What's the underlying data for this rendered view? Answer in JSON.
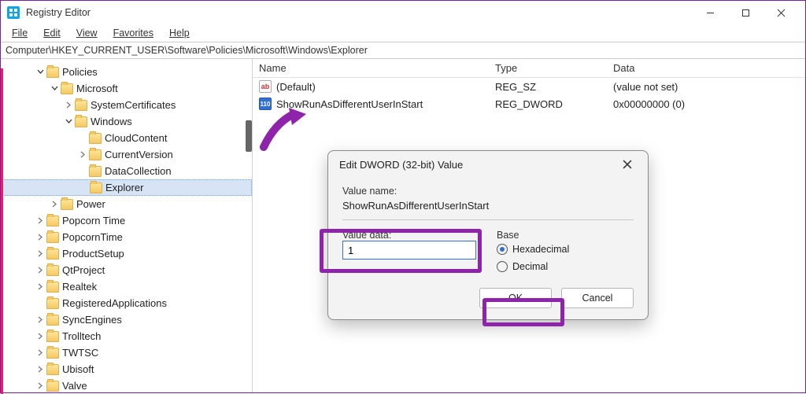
{
  "window": {
    "title": "Registry Editor"
  },
  "menu": {
    "file": "File",
    "edit": "Edit",
    "view": "View",
    "favorites": "Favorites",
    "help": "Help"
  },
  "address": "Computer\\HKEY_CURRENT_USER\\Software\\Policies\\Microsoft\\Windows\\Explorer",
  "tree": {
    "policies": "Policies",
    "microsoft": "Microsoft",
    "systemcertificates": "SystemCertificates",
    "windows": "Windows",
    "cloudcontent": "CloudContent",
    "currentversion": "CurrentVersion",
    "datacollection": "DataCollection",
    "explorer": "Explorer",
    "power": "Power",
    "popcorntime": "Popcorn Time",
    "popcorntime2": "PopcornTime",
    "productsetup": "ProductSetup",
    "qtproject": "QtProject",
    "realtek": "Realtek",
    "registeredapplications": "RegisteredApplications",
    "syncengines": "SyncEngines",
    "trolltech": "Trolltech",
    "twtsc": "TWTSC",
    "ubisoft": "Ubisoft",
    "valve": "Valve"
  },
  "columns": {
    "name": "Name",
    "type": "Type",
    "data": "Data"
  },
  "rows": [
    {
      "icon": "str",
      "name": "(Default)",
      "type": "REG_SZ",
      "data": "(value not set)"
    },
    {
      "icon": "dw",
      "name": "ShowRunAsDifferentUserInStart",
      "type": "REG_DWORD",
      "data": "0x00000000 (0)"
    }
  ],
  "dialog": {
    "title": "Edit DWORD (32-bit) Value",
    "valuename_label": "Value name:",
    "valuename": "ShowRunAsDifferentUserInStart",
    "valuedata_label": "Value data:",
    "valuedata": "1",
    "base_label": "Base",
    "hex": "Hexadecimal",
    "dec": "Decimal",
    "ok": "OK",
    "cancel": "Cancel"
  },
  "icon_text": {
    "str": "ab",
    "dw": "110"
  }
}
